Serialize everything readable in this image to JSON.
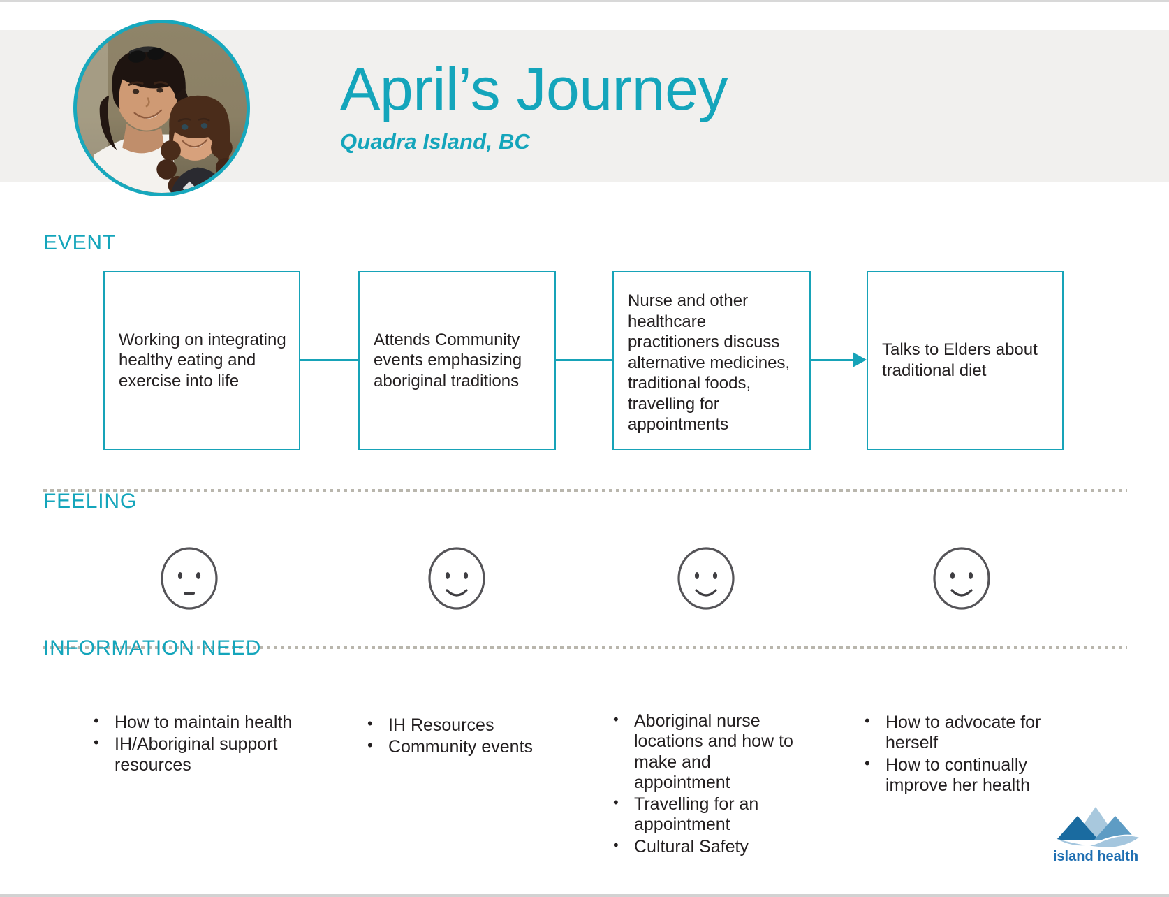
{
  "header": {
    "title": "April’s Journey",
    "subtitle": "Quadra Island, BC",
    "avatar_alt": "portrait-of-mother-and-daughter",
    "accent_color": "#14a5bb",
    "band_color": "#f1f0ee"
  },
  "sections": {
    "event_label": "EVENT",
    "feeling_label": "FEELING",
    "information_need_label": "INFORMATION NEED"
  },
  "events": [
    {
      "text": "Working on integrating healthy eating and exercise into life"
    },
    {
      "text": "Attends Community events emphasizing aboriginal traditions"
    },
    {
      "text": "Nurse and other healthcare practitioners discuss alternative medicines, traditional foods, travelling for appointments"
    },
    {
      "text": "Talks to Elders about traditional diet"
    }
  ],
  "feelings": [
    {
      "mood": "neutral"
    },
    {
      "mood": "happy"
    },
    {
      "mood": "happy"
    },
    {
      "mood": "happy"
    }
  ],
  "information_needs": [
    {
      "items": [
        "How to maintain health",
        "IH/Aboriginal support resources"
      ]
    },
    {
      "items": [
        "IH Resources",
        "Community events"
      ]
    },
    {
      "items": [
        "Aboriginal nurse locations and how to make and appointment",
        "Travelling for an appointment",
        "Cultural Safety"
      ]
    },
    {
      "items": [
        "How to advocate for herself",
        "How to continually improve her health"
      ]
    }
  ],
  "logo": {
    "name": "island health",
    "colors": {
      "peak_dark": "#1a6ba0",
      "peak_light": "#a8c8dd",
      "peak_mid": "#5e9cc4",
      "wave": "#9fc3dc",
      "text": "#1f6fb2"
    }
  }
}
